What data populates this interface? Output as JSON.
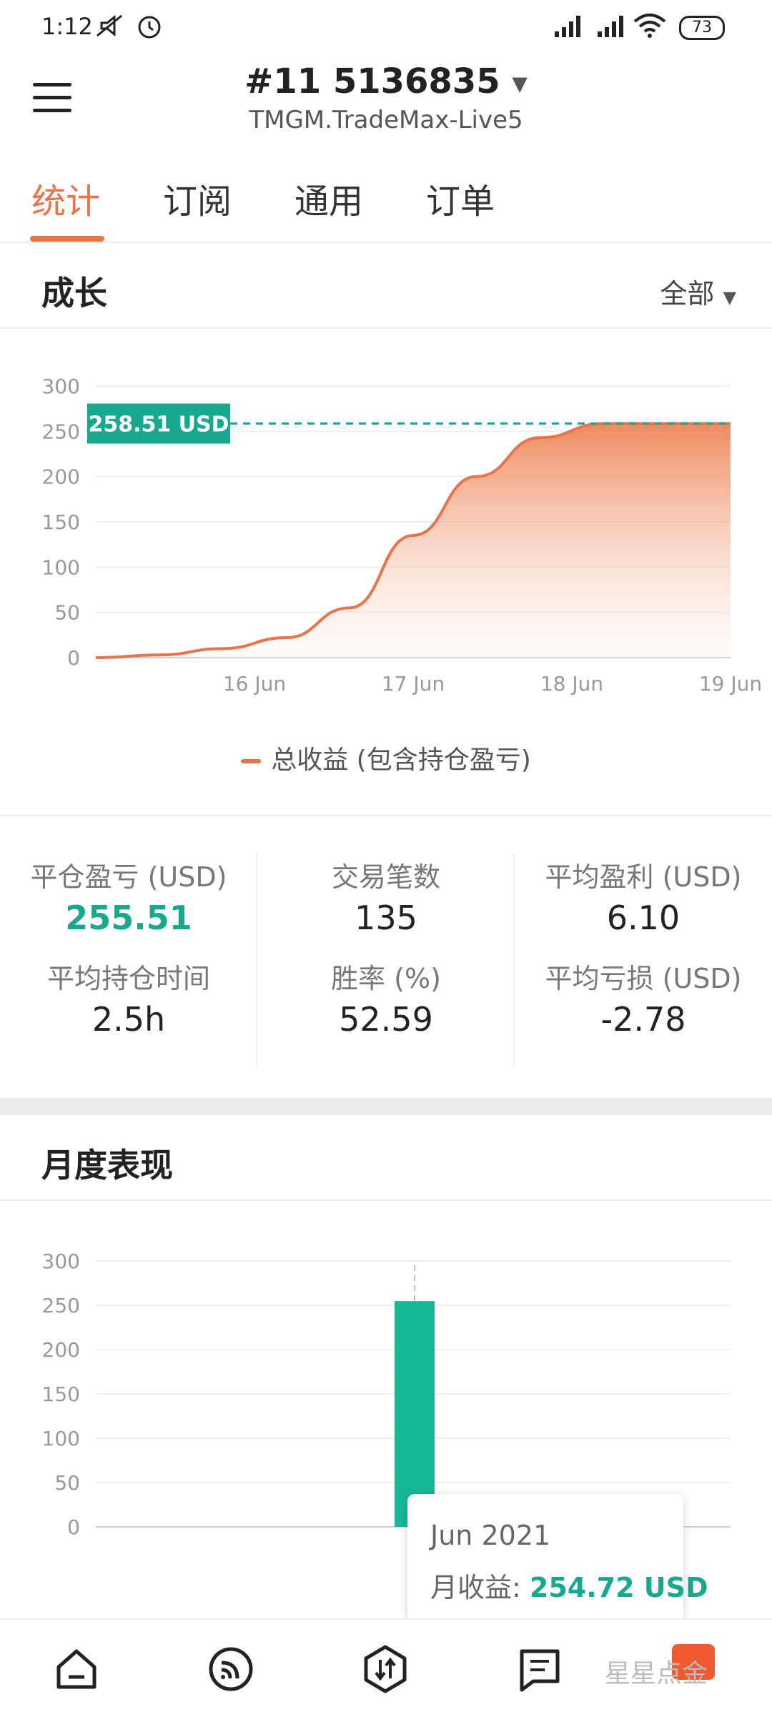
{
  "status_bar": {
    "time": "1:12",
    "battery": "73"
  },
  "header": {
    "account": "#11  5136835",
    "server": "TMGM.TradeMax-Live5"
  },
  "tabs": [
    {
      "label": "统计",
      "active": true
    },
    {
      "label": "订阅",
      "active": false
    },
    {
      "label": "通用",
      "active": false
    },
    {
      "label": "订单",
      "active": false
    }
  ],
  "growth": {
    "title": "成长",
    "range": "全部",
    "badge": "258.51 USD",
    "legend": "总收益 (包含持仓盈亏)"
  },
  "stats": {
    "closed_pnl_label": "平仓盈亏 (USD)",
    "closed_pnl": "255.51",
    "trades_label": "交易笔数",
    "trades": "135",
    "avg_profit_label": "平均盈利 (USD)",
    "avg_profit": "6.10",
    "avg_hold_label": "平均持仓时间",
    "avg_hold": "2.5h",
    "win_rate_label": "胜率 (%)",
    "win_rate": "52.59",
    "avg_loss_label": "平均亏损 (USD)",
    "avg_loss": "-2.78"
  },
  "monthly": {
    "title": "月度表现",
    "tooltip_month": "Jun 2021",
    "tooltip_label": "月收益: ",
    "tooltip_value": "254.72 USD"
  },
  "watermark": "星星点金",
  "colors": {
    "accent": "#e8744a",
    "positive": "#17a88d"
  },
  "chart_data": [
    {
      "type": "area",
      "title": "成长",
      "x": [
        "15 Jun 12:00",
        "16 Jun 00:00",
        "16 Jun 12:00",
        "17 Jun 00:00",
        "17 Jun 12:00",
        "18 Jun 00:00",
        "18 Jun 12:00",
        "19 Jun 00:00"
      ],
      "xticks": [
        "16 Jun",
        "17 Jun",
        "18 Jun",
        "19 Jun"
      ],
      "series": [
        {
          "name": "总收益 (包含持仓盈亏)",
          "values": [
            0,
            3,
            10,
            22,
            55,
            135,
            200,
            243,
            258.51,
            258.51,
            258.51
          ]
        }
      ],
      "ylim": [
        0,
        300
      ],
      "yticks": [
        0,
        50,
        100,
        150,
        200,
        250,
        300
      ],
      "reference_line": 258.51,
      "grid": true
    },
    {
      "type": "bar",
      "title": "月度表现",
      "categories": [
        "Jun 2021"
      ],
      "series": [
        {
          "values": [
            254.72
          ]
        }
      ],
      "ylim": [
        0,
        300
      ],
      "yticks": [
        0,
        50,
        100,
        150,
        200,
        250,
        300
      ],
      "grid": true
    }
  ]
}
